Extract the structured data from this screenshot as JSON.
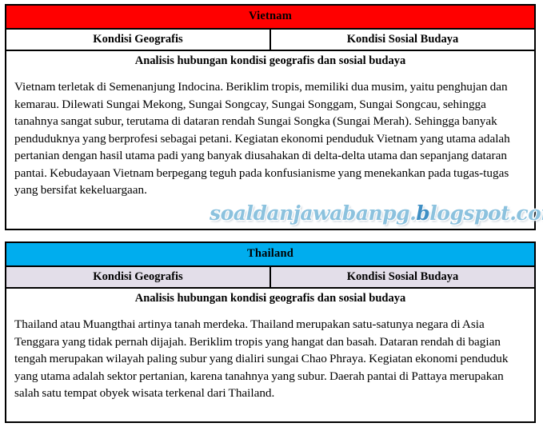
{
  "colors": {
    "vietnam_header_bg": "#ff0000",
    "thailand_header_bg": "#00adee",
    "thailand_subheader_bg": "#e3dee9",
    "vietnam_subheader_bg": "#ffffff",
    "border": "#000000",
    "watermark": "#8cc2de",
    "watermark_accent": "#3f8fc4"
  },
  "tables": [
    {
      "title": "Vietnam",
      "columns": [
        "Kondisi Geografis",
        "Kondisi Sosial Budaya"
      ],
      "analysis_heading": "Analisis hubungan kondisi geografis dan sosial budaya",
      "body": "Vietnam terletak di Semenanjung Indocina. Beriklim tropis, memiliki dua musim, yaitu penghujan dan kemarau. Dilewati Sungai Mekong, Sungai Songcay, Sungai Songgam, Sungai Songcau, sehingga tanahnya sangat subur, terutama di dataran rendah Sungai Songka (Sungai Merah). Sehingga banyak penduduknya yang berprofesi sebagai petani. Kegiatan ekonomi penduduk Vietnam yang utama adalah pertanian dengan hasil utama padi yang banyak diusahakan di delta-delta utama dan sepanjang dataran pantai. Kebudayaan Vietnam berpegang teguh pada konfusianisme yang menekankan pada tugas-tugas yang bersifat kekeluargaan."
    },
    {
      "title": "Thailand",
      "columns": [
        "Kondisi Geografis",
        "Kondisi Sosial Budaya"
      ],
      "analysis_heading": "Analisis hubungan kondisi geografis dan sosial budaya",
      "body": "Thailand atau Muangthai artinya tanah merdeka. Thailand merupakan satu-satunya negara di Asia Tenggara yang tidak pernah dijajah. Beriklim tropis yang hangat dan basah. Dataran rendah di bagian tengah merupakan wilayah paling subur yang dialiri sungai Chao Phraya. Kegiatan ekonomi penduduk yang utama adalah sektor pertanian, karena tanahnya yang subur. Daerah pantai di Pattaya merupakan salah satu tempat obyek wisata terkenal dari Thailand."
    }
  ],
  "watermark": {
    "prefix": "soaldanjawabanpg.",
    "accent": "b",
    "suffix": "logspot.com"
  }
}
